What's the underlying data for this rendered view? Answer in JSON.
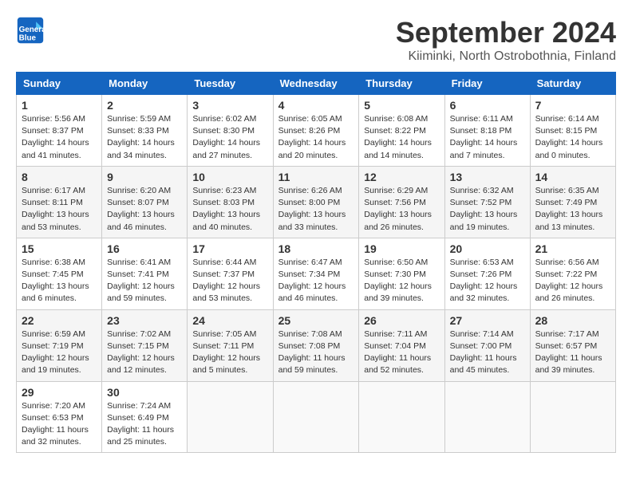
{
  "header": {
    "logo_line1": "General",
    "logo_line2": "Blue",
    "month": "September 2024",
    "location": "Kiiminki, North Ostrobothnia, Finland"
  },
  "weekdays": [
    "Sunday",
    "Monday",
    "Tuesday",
    "Wednesday",
    "Thursday",
    "Friday",
    "Saturday"
  ],
  "weeks": [
    [
      {
        "day": 1,
        "info": "Sunrise: 5:56 AM\nSunset: 8:37 PM\nDaylight: 14 hours\nand 41 minutes."
      },
      {
        "day": 2,
        "info": "Sunrise: 5:59 AM\nSunset: 8:33 PM\nDaylight: 14 hours\nand 34 minutes."
      },
      {
        "day": 3,
        "info": "Sunrise: 6:02 AM\nSunset: 8:30 PM\nDaylight: 14 hours\nand 27 minutes."
      },
      {
        "day": 4,
        "info": "Sunrise: 6:05 AM\nSunset: 8:26 PM\nDaylight: 14 hours\nand 20 minutes."
      },
      {
        "day": 5,
        "info": "Sunrise: 6:08 AM\nSunset: 8:22 PM\nDaylight: 14 hours\nand 14 minutes."
      },
      {
        "day": 6,
        "info": "Sunrise: 6:11 AM\nSunset: 8:18 PM\nDaylight: 14 hours\nand 7 minutes."
      },
      {
        "day": 7,
        "info": "Sunrise: 6:14 AM\nSunset: 8:15 PM\nDaylight: 14 hours\nand 0 minutes."
      }
    ],
    [
      {
        "day": 8,
        "info": "Sunrise: 6:17 AM\nSunset: 8:11 PM\nDaylight: 13 hours\nand 53 minutes."
      },
      {
        "day": 9,
        "info": "Sunrise: 6:20 AM\nSunset: 8:07 PM\nDaylight: 13 hours\nand 46 minutes."
      },
      {
        "day": 10,
        "info": "Sunrise: 6:23 AM\nSunset: 8:03 PM\nDaylight: 13 hours\nand 40 minutes."
      },
      {
        "day": 11,
        "info": "Sunrise: 6:26 AM\nSunset: 8:00 PM\nDaylight: 13 hours\nand 33 minutes."
      },
      {
        "day": 12,
        "info": "Sunrise: 6:29 AM\nSunset: 7:56 PM\nDaylight: 13 hours\nand 26 minutes."
      },
      {
        "day": 13,
        "info": "Sunrise: 6:32 AM\nSunset: 7:52 PM\nDaylight: 13 hours\nand 19 minutes."
      },
      {
        "day": 14,
        "info": "Sunrise: 6:35 AM\nSunset: 7:49 PM\nDaylight: 13 hours\nand 13 minutes."
      }
    ],
    [
      {
        "day": 15,
        "info": "Sunrise: 6:38 AM\nSunset: 7:45 PM\nDaylight: 13 hours\nand 6 minutes."
      },
      {
        "day": 16,
        "info": "Sunrise: 6:41 AM\nSunset: 7:41 PM\nDaylight: 12 hours\nand 59 minutes."
      },
      {
        "day": 17,
        "info": "Sunrise: 6:44 AM\nSunset: 7:37 PM\nDaylight: 12 hours\nand 53 minutes."
      },
      {
        "day": 18,
        "info": "Sunrise: 6:47 AM\nSunset: 7:34 PM\nDaylight: 12 hours\nand 46 minutes."
      },
      {
        "day": 19,
        "info": "Sunrise: 6:50 AM\nSunset: 7:30 PM\nDaylight: 12 hours\nand 39 minutes."
      },
      {
        "day": 20,
        "info": "Sunrise: 6:53 AM\nSunset: 7:26 PM\nDaylight: 12 hours\nand 32 minutes."
      },
      {
        "day": 21,
        "info": "Sunrise: 6:56 AM\nSunset: 7:22 PM\nDaylight: 12 hours\nand 26 minutes."
      }
    ],
    [
      {
        "day": 22,
        "info": "Sunrise: 6:59 AM\nSunset: 7:19 PM\nDaylight: 12 hours\nand 19 minutes."
      },
      {
        "day": 23,
        "info": "Sunrise: 7:02 AM\nSunset: 7:15 PM\nDaylight: 12 hours\nand 12 minutes."
      },
      {
        "day": 24,
        "info": "Sunrise: 7:05 AM\nSunset: 7:11 PM\nDaylight: 12 hours\nand 5 minutes."
      },
      {
        "day": 25,
        "info": "Sunrise: 7:08 AM\nSunset: 7:08 PM\nDaylight: 11 hours\nand 59 minutes."
      },
      {
        "day": 26,
        "info": "Sunrise: 7:11 AM\nSunset: 7:04 PM\nDaylight: 11 hours\nand 52 minutes."
      },
      {
        "day": 27,
        "info": "Sunrise: 7:14 AM\nSunset: 7:00 PM\nDaylight: 11 hours\nand 45 minutes."
      },
      {
        "day": 28,
        "info": "Sunrise: 7:17 AM\nSunset: 6:57 PM\nDaylight: 11 hours\nand 39 minutes."
      }
    ],
    [
      {
        "day": 29,
        "info": "Sunrise: 7:20 AM\nSunset: 6:53 PM\nDaylight: 11 hours\nand 32 minutes."
      },
      {
        "day": 30,
        "info": "Sunrise: 7:24 AM\nSunset: 6:49 PM\nDaylight: 11 hours\nand 25 minutes."
      },
      null,
      null,
      null,
      null,
      null
    ]
  ]
}
